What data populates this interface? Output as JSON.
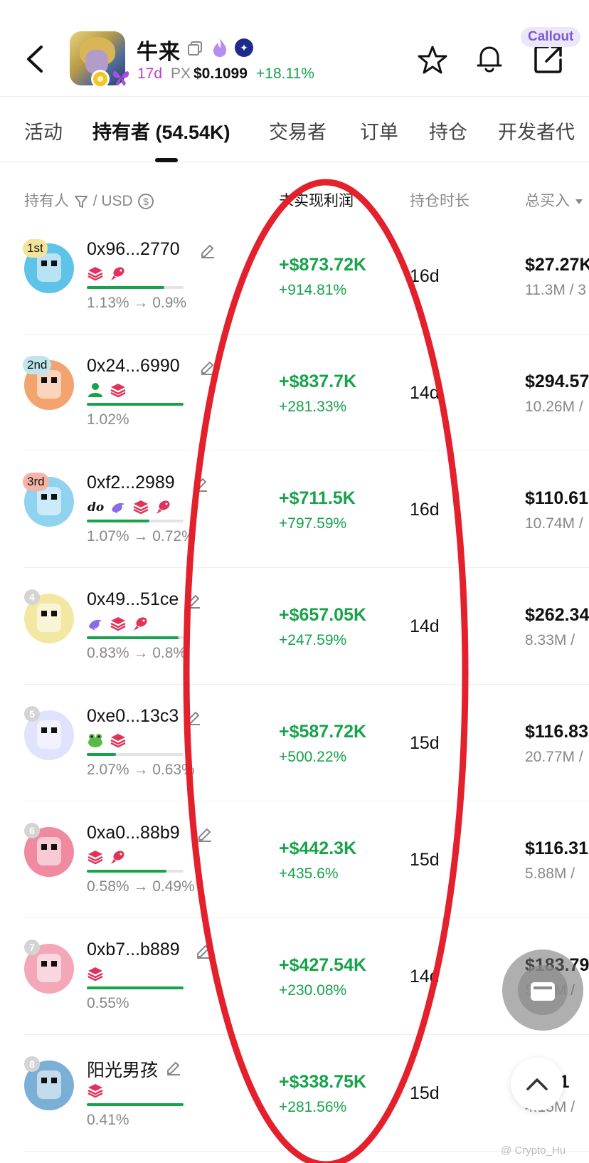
{
  "header": {
    "token_name": "牛来",
    "age": "17d",
    "px_label": "PX",
    "price": "$0.1099",
    "change": "+18.11%",
    "callout_label": "Callout"
  },
  "tabs": [
    {
      "label": "活动"
    },
    {
      "label": "持有者 (54.54K)"
    },
    {
      "label": "交易者"
    },
    {
      "label": "订单"
    },
    {
      "label": "持仓"
    },
    {
      "label": "开发者代"
    }
  ],
  "columns": {
    "holder": "持有人",
    "usd": "/ USD",
    "pnl": "未实现利润",
    "hold_time": "持仓时长",
    "total_buy": "总买入"
  },
  "holders": [
    {
      "rank": "1st",
      "address": "0x96...2770",
      "share": "1.13% → 0.9%",
      "share_level": 0.8,
      "pnl": "+$873.72K",
      "pnl_pct": "+914.81%",
      "hold": "16d",
      "buy": "$27.27K",
      "buy_sub": "11.3M / 3",
      "tags": [
        "layers-icon",
        "fish-icon"
      ],
      "color": "#5fc2e8"
    },
    {
      "rank": "2nd",
      "address": "0x24...6990",
      "share": "1.02%",
      "share_level": 1.0,
      "pnl": "+$837.7K",
      "pnl_pct": "+281.33%",
      "hold": "14d",
      "buy": "$294.57",
      "buy_sub": "10.26M /",
      "tags": [
        "user-icon",
        "layers-icon"
      ],
      "color": "#f2a36e"
    },
    {
      "rank": "3rd",
      "address": "0xf2...2989",
      "share": "1.07% → 0.72%",
      "share_level": 0.65,
      "pnl": "+$711.5K",
      "pnl_pct": "+797.59%",
      "hold": "16d",
      "buy": "$110.61",
      "buy_sub": "10.74M /",
      "tags": [
        "dev-icon",
        "dolphin-icon",
        "layers-icon",
        "fish-icon"
      ],
      "color": "#8fd3f0"
    },
    {
      "rank": "4",
      "address": "0x49...51ce",
      "share": "0.83% → 0.8%",
      "share_level": 0.95,
      "pnl": "+$657.05K",
      "pnl_pct": "+247.59%",
      "hold": "14d",
      "buy": "$262.34",
      "buy_sub": "8.33M /",
      "tags": [
        "dolphin-icon",
        "layers-icon",
        "fish-icon"
      ],
      "color": "#f3e7a4"
    },
    {
      "rank": "5",
      "address": "0xe0...13c3",
      "share": "2.07% → 0.63%",
      "share_level": 0.3,
      "pnl": "+$587.72K",
      "pnl_pct": "+500.22%",
      "hold": "15d",
      "buy": "$116.83",
      "buy_sub": "20.77M /",
      "tags": [
        "frog-icon",
        "layers-icon"
      ],
      "color": "#dfe3fb"
    },
    {
      "rank": "6",
      "address": "0xa0...88b9",
      "share": "0.58% → 0.49%",
      "share_level": 0.82,
      "pnl": "+$442.3K",
      "pnl_pct": "+435.6%",
      "hold": "15d",
      "buy": "$116.31",
      "buy_sub": "5.88M /",
      "tags": [
        "layers-icon",
        "fish-icon"
      ],
      "color": "#f08aa0"
    },
    {
      "rank": "7",
      "address": "0xb7...b889",
      "share": "0.55%",
      "share_level": 1.0,
      "pnl": "+$427.54K",
      "pnl_pct": "+230.08%",
      "hold": "14d",
      "buy": "$183.79",
      "buy_sub": "5.54M /",
      "tags": [
        "layers-icon"
      ],
      "color": "#f3a7b8"
    },
    {
      "rank": "8",
      "address": "阳光男孩",
      "share": "0.41%",
      "share_level": 1.0,
      "pnl": "+$338.75K",
      "pnl_pct": "+281.56%",
      "hold": "15d",
      "buy": "$2.01",
      "buy_sub": "4.15M /",
      "tags": [
        "layers-icon"
      ],
      "color": "#7ab0d6"
    }
  ],
  "watermark": "@ Crypto_Hu",
  "colors": {
    "positive": "#16a34a",
    "annotation": "#e3202b",
    "accent": "#7c5ad6"
  }
}
